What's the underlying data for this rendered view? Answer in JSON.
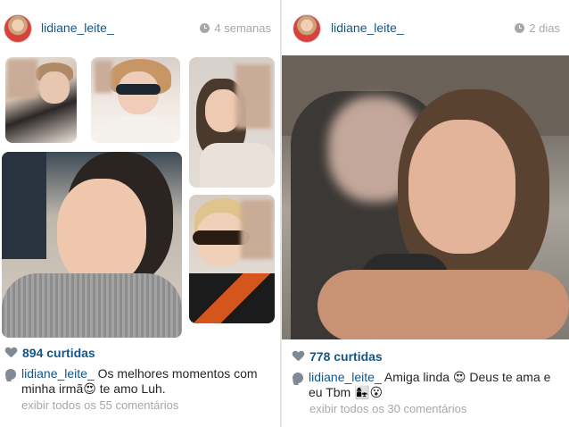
{
  "left_post": {
    "username": "lidiane_leite_",
    "time": "4 semanas",
    "likes": "894 curtidas",
    "caption_user": "lidiane_leite_",
    "caption_text": "Os melhores momentos com minha irmã😍 te amo Luh.",
    "view_comments": "exibir todos os 55 comentários"
  },
  "right_post": {
    "username": "lidiane_leite_",
    "time": "2 dias",
    "likes": "778 curtidas",
    "caption_user": "lidiane_leite_",
    "caption_text": "Amiga linda 😍 Deus te ama e eu Tbm 👩‍👧😮",
    "view_comments": "exibir todos os 30 comentários"
  },
  "colors": {
    "link_blue": "#125688",
    "muted_gray": "#a5a7aa",
    "icon_gray": "#7f8a94"
  },
  "icons": [
    "clock-icon",
    "heart-icon",
    "comment-icon"
  ]
}
